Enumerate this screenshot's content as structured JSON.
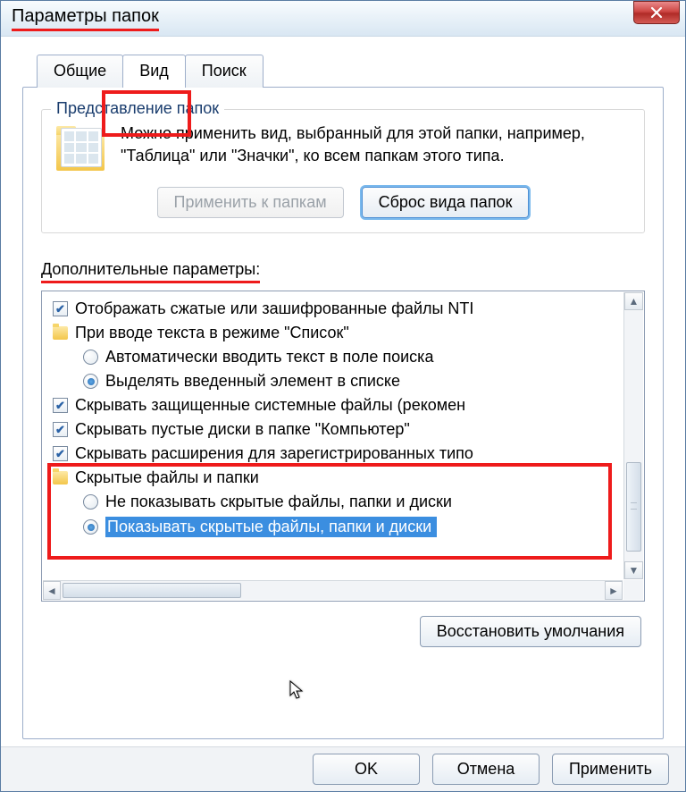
{
  "window": {
    "title": "Параметры папок"
  },
  "tabs": {
    "general": "Общие",
    "view": "Вид",
    "search": "Поиск"
  },
  "folderview": {
    "legend": "Представление папок",
    "text": "Можно применить вид, выбранный для этой папки, например, \"Таблица\" или \"Значки\", ко всем папкам этого типа.",
    "apply": "Применить к папкам",
    "reset": "Сброс вида папок"
  },
  "advanced": {
    "label": "Дополнительные параметры:",
    "items": {
      "compressed": "Отображать сжатые или зашифрованные файлы NTI",
      "list_input": "При вводе текста в режиме \"Список\"",
      "auto_search": "Автоматически вводить текст в поле поиска",
      "highlight_typed": "Выделять введенный элемент в списке",
      "hide_protected": "Скрывать защищенные системные файлы (рекомен",
      "hide_empty": "Скрывать пустые диски в папке \"Компьютер\"",
      "hide_ext": "Скрывать расширения для зарегистрированных типо",
      "hidden_group": "Скрытые файлы и папки",
      "dont_show_hidden": "Не показывать скрытые файлы, папки и диски",
      "show_hidden": "Показывать скрытые файлы, папки и диски"
    }
  },
  "buttons": {
    "restore": "Восстановить умолчания",
    "ok": "OK",
    "cancel": "Отмена",
    "apply": "Применить"
  }
}
